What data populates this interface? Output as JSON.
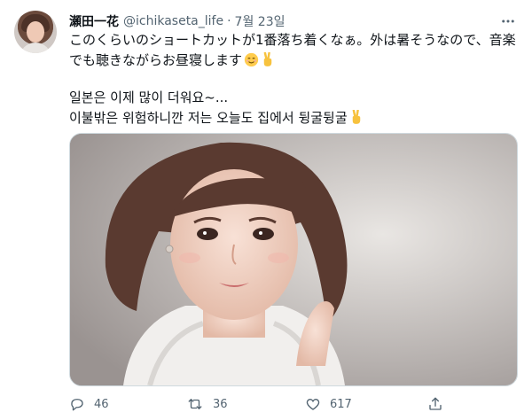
{
  "tweet": {
    "display_name": "瀬田一花",
    "handle": "@ichikaseta_life",
    "separator": "·",
    "date": "7월 23일",
    "text_line_1": "このくらいのショートカットが1番落ち着くなぁ。外は暑そうなので、音楽",
    "text_line_2": "でも聴きながらお昼寝します",
    "text_line_3": "일본은 이제 많이 더워요~...",
    "text_line_4": "이불밖은 위험하니깐 저는 오늘도 집에서 뒹굴뒹굴",
    "emoji_1": "relieved-face-emoji",
    "emoji_2": "victory-hand-emoji",
    "emoji_3": "victory-hand-emoji"
  },
  "media": {
    "description": "photo"
  },
  "actions": {
    "reply_count": "46",
    "retweet_count": "36",
    "like_count": "617",
    "reply_icon": "reply-icon",
    "retweet_icon": "retweet-icon",
    "like_icon": "heart-icon",
    "share_icon": "share-icon"
  },
  "colors": {
    "text_primary": "#0f1419",
    "text_secondary": "#536471",
    "border": "#cfd9de"
  }
}
